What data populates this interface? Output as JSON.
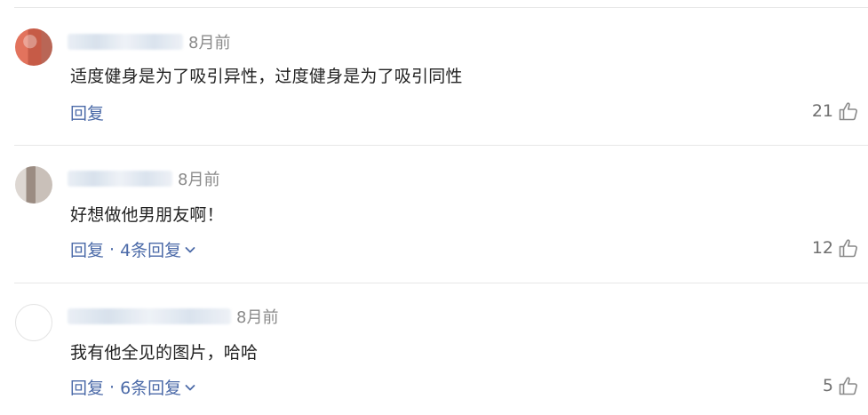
{
  "comments": [
    {
      "time": "8月前",
      "text": "适度健身是为了吸引异性，过度健身是为了吸引同性",
      "reply_label": "回复",
      "replies_count_label": "",
      "likes": "21",
      "icons": {
        "like": "thumbs-up-icon"
      }
    },
    {
      "time": "8月前",
      "text": "好想做他男朋友啊！",
      "reply_label": "回复",
      "replies_count_label": "4条回复",
      "likes": "12",
      "icons": {
        "like": "thumbs-up-icon",
        "expand": "chevron-down-icon"
      }
    },
    {
      "time": "8月前",
      "text": "我有他全见的图片，哈哈",
      "reply_label": "回复",
      "replies_count_label": "6条回复",
      "likes": "5",
      "icons": {
        "like": "thumbs-up-icon",
        "expand": "chevron-down-icon"
      }
    }
  ],
  "separator": "·",
  "colors": {
    "link": "#4b6aa8",
    "meta": "#8a8a8a",
    "text": "#222222",
    "divider": "#e7e7e7"
  }
}
